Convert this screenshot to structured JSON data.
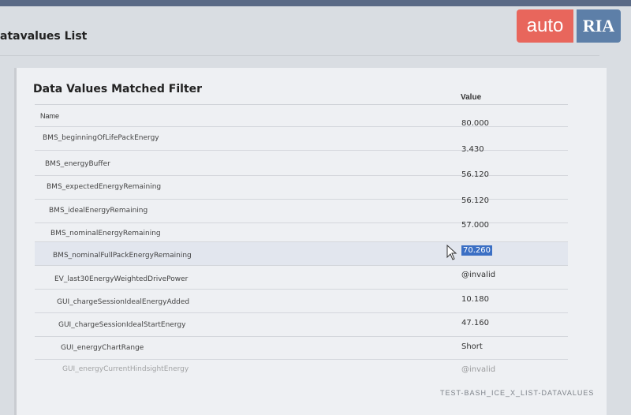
{
  "page_title": "atavalues List",
  "panel": {
    "title": "Data Values Matched Filter",
    "columns": {
      "name": "Name",
      "value": "Value"
    },
    "rows": [
      {
        "name": "BMS_beginningOfLifePackEnergy",
        "value": "80.000"
      },
      {
        "name": "BMS_energyBuffer",
        "value": "3.430"
      },
      {
        "name": "BMS_expectedEnergyRemaining",
        "value": "56.120"
      },
      {
        "name": "BMS_idealEnergyRemaining",
        "value": "56.120"
      },
      {
        "name": "BMS_nominalEnergyRemaining",
        "value": "57.000"
      },
      {
        "name": "BMS_nominalFullPackEnergyRemaining",
        "value": "70.260"
      },
      {
        "name": "EV_last30EnergyWeightedDrivePower",
        "value": "@invalid"
      },
      {
        "name": "GUI_chargeSessionIdealEnergyAdded",
        "value": "10.180"
      },
      {
        "name": "GUI_chargeSessionIdealStartEnergy",
        "value": "47.160"
      },
      {
        "name": "GUI_energyChartRange",
        "value": "Short"
      },
      {
        "name": "GUI_energyCurrentHindsightEnergy",
        "value": "@invalid"
      }
    ],
    "selected_row_index": 5
  },
  "footer_id": "TEST-BASH_ICE_X_LIST-DATAVALUES",
  "watermark": {
    "auto": "auto",
    "ria": "RIA"
  },
  "colors": {
    "highlight": "#3b6fc4",
    "auto_bg": "#e8665c",
    "ria_bg": "#5d7fa8"
  }
}
